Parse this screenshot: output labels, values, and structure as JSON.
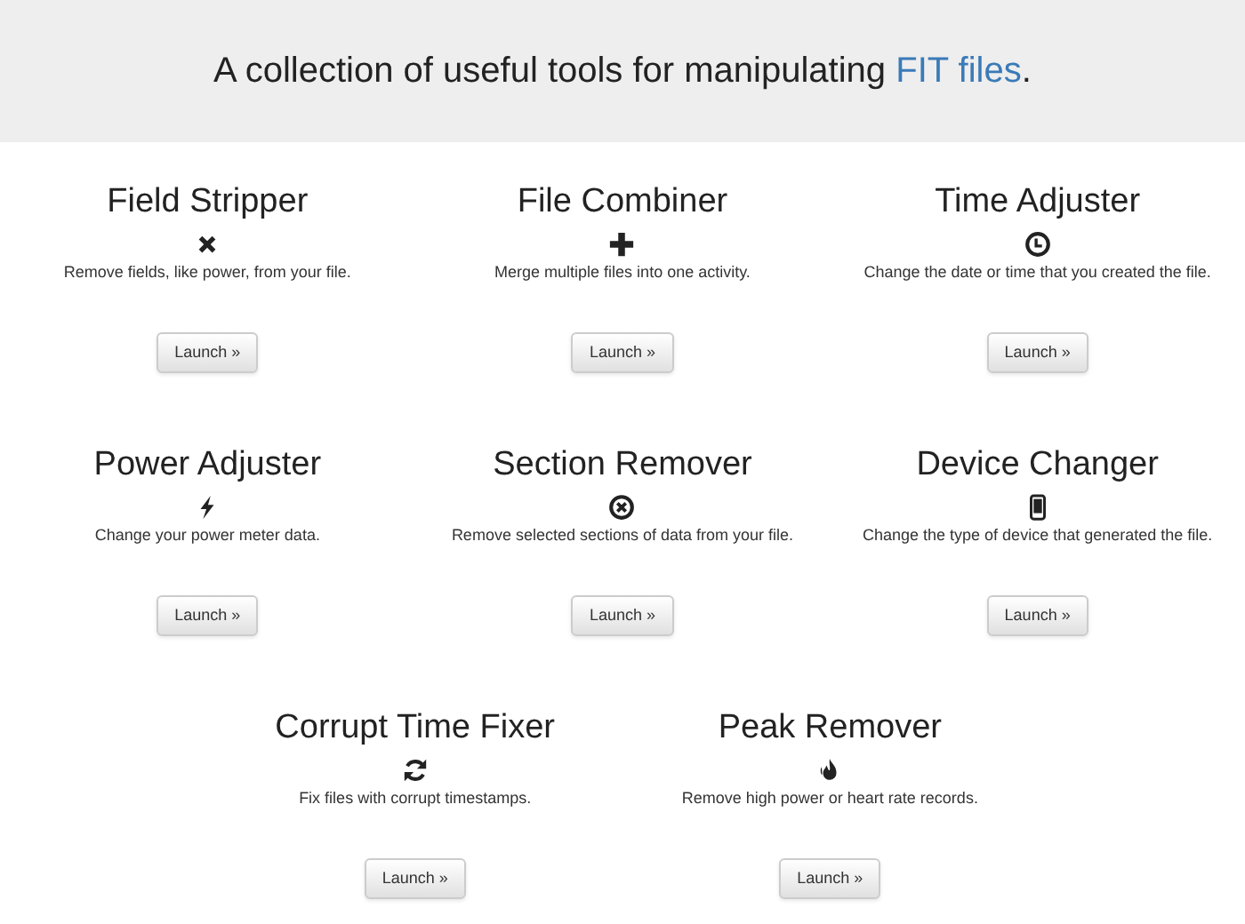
{
  "hero": {
    "text_before": "A collection of useful tools for manipulating ",
    "link": "FIT files",
    "text_after": "."
  },
  "tools": [
    {
      "title": "Field Stripper",
      "kind": "cross",
      "description": "Remove fields, like power, from your file.",
      "button": "Launch »"
    },
    {
      "title": "File Combiner",
      "kind": "plus",
      "description": "Merge multiple files into one activity.",
      "button": "Launch »"
    },
    {
      "title": "Time Adjuster",
      "kind": "clock",
      "description": "Change the date or time that you created the file.",
      "button": "Launch »"
    },
    {
      "title": "Power Adjuster",
      "kind": "bolt",
      "description": "Change your power meter data.",
      "button": "Launch »"
    },
    {
      "title": "Section Remover",
      "kind": "remove-circle",
      "description": "Remove selected sections of data from your file.",
      "button": "Launch »"
    },
    {
      "title": "Device Changer",
      "kind": "phone",
      "description": "Change the type of device that generated the file.",
      "button": "Launch »"
    },
    {
      "title": "Corrupt Time Fixer",
      "kind": "refresh",
      "description": "Fix files with corrupt timestamps.",
      "button": "Launch »"
    },
    {
      "title": "Peak Remover",
      "kind": "fire",
      "description": "Remove high power or heart rate records.",
      "button": "Launch »"
    }
  ]
}
